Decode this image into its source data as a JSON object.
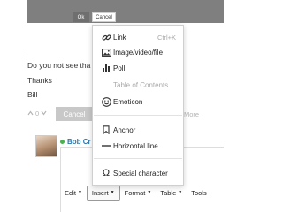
{
  "dialog": {
    "ok_label": "Ok",
    "cancel_label": "Cancel"
  },
  "message": {
    "line1": "Do you not see tha",
    "line2": "Thanks",
    "line3": "Bill"
  },
  "reply_bar": {
    "vote_count": "0",
    "cancel_label": "Cancel",
    "more_label": "More"
  },
  "user": {
    "name": "Bob Cr"
  },
  "toolbar": {
    "items": [
      "Edit",
      "Insert",
      "Format",
      "Table",
      "Tools"
    ]
  },
  "insert_menu": {
    "link": {
      "label": "Link",
      "shortcut": "Ctrl+K"
    },
    "image": {
      "label": "Image/video/file"
    },
    "poll": {
      "label": "Poll"
    },
    "toc": {
      "label": "Table of Contents"
    },
    "emoticon": {
      "label": "Emoticon"
    },
    "anchor": {
      "label": "Anchor"
    },
    "hr": {
      "label": "Horizontal line"
    },
    "special": {
      "label": "Special character"
    }
  }
}
